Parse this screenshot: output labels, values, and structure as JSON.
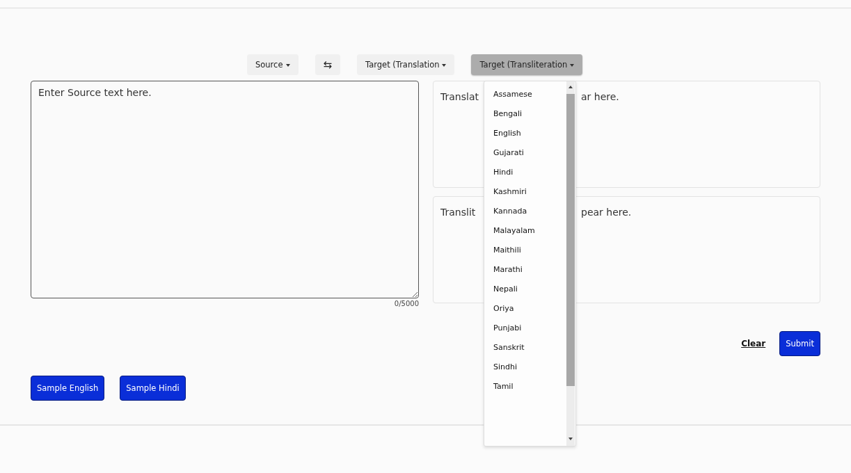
{
  "toolbar": [
    {
      "label": "Source",
      "kind": "dropdown",
      "active": false
    },
    {
      "label": "⇆",
      "kind": "swap",
      "active": false
    },
    {
      "label": "Target (Translation",
      "kind": "dropdown",
      "active": false
    },
    {
      "label": "Target (Transliteration",
      "kind": "dropdown",
      "active": true
    }
  ],
  "source": {
    "placeholder": "Enter Source text here.",
    "counter": "0/5000"
  },
  "outputs": [
    {
      "visible_start": "Translat",
      "visible_end": "ar here."
    },
    {
      "visible_start": "Translit",
      "visible_end": "pear here."
    }
  ],
  "dropdown": {
    "options": [
      "Assamese",
      "Bengali",
      "English",
      "Gujarati",
      "Hindi",
      "Kashmiri",
      "Kannada",
      "Malayalam",
      "Maithili",
      "Marathi",
      "Nepali",
      "Oriya",
      "Punjabi",
      "Sanskrit",
      "Sindhi",
      "Tamil"
    ]
  },
  "actions": {
    "clear": "Clear",
    "submit": "Submit"
  },
  "samples": [
    "Sample English",
    "Sample Hindi"
  ]
}
